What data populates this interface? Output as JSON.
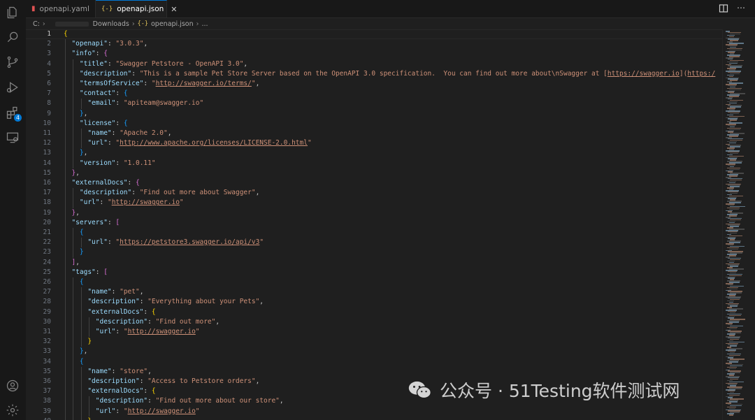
{
  "tabs": [
    {
      "label": "openapi.yaml",
      "icon": "yaml-icon",
      "active": false
    },
    {
      "label": "openapi.json",
      "icon": "{-}",
      "active": true
    }
  ],
  "tab_close": "✕",
  "breadcrumb": {
    "drive": "C:",
    "folder": "Downloads",
    "file_icon": "{-}",
    "file": "openapi.json",
    "ellipsis": "..."
  },
  "activity_badge": "4",
  "editor": {
    "current_line": 1,
    "lines": [
      "{",
      "  \"openapi\": \"3.0.3\",",
      "  \"info\": {",
      "    \"title\": \"Swagger Petstore - OpenAPI 3.0\",",
      "    \"description\": \"This is a sample Pet Store Server based on the OpenAPI 3.0 specification.  You can find out more about\\nSwagger at [https://swagger.io](https:/",
      "    \"termsOfService\": \"http://swagger.io/terms/\",",
      "    \"contact\": {",
      "      \"email\": \"apiteam@swagger.io\"",
      "    },",
      "    \"license\": {",
      "      \"name\": \"Apache 2.0\",",
      "      \"url\": \"http://www.apache.org/licenses/LICENSE-2.0.html\"",
      "    },",
      "    \"version\": \"1.0.11\"",
      "  },",
      "  \"externalDocs\": {",
      "    \"description\": \"Find out more about Swagger\",",
      "    \"url\": \"http://swagger.io\"",
      "  },",
      "  \"servers\": [",
      "    {",
      "      \"url\": \"https://petstore3.swagger.io/api/v3\"",
      "    }",
      "  ],",
      "  \"tags\": [",
      "    {",
      "      \"name\": \"pet\",",
      "      \"description\": \"Everything about your Pets\",",
      "      \"externalDocs\": {",
      "        \"description\": \"Find out more\",",
      "        \"url\": \"http://swagger.io\"",
      "      }",
      "    },",
      "    {",
      "      \"name\": \"store\",",
      "      \"description\": \"Access to Petstore orders\",",
      "      \"externalDocs\": {",
      "        \"description\": \"Find out more about our store\",",
      "        \"url\": \"http://swagger.io\"",
      "      }"
    ]
  },
  "watermark": "公众号 · 51Testing软件测试网",
  "colors": {
    "key": "#9cdcfe",
    "string": "#ce9178",
    "bracket_level1": "#ffd700",
    "bracket_level2": "#da70d6",
    "bracket_level3": "#179fff",
    "accent": "#0078d4"
  }
}
